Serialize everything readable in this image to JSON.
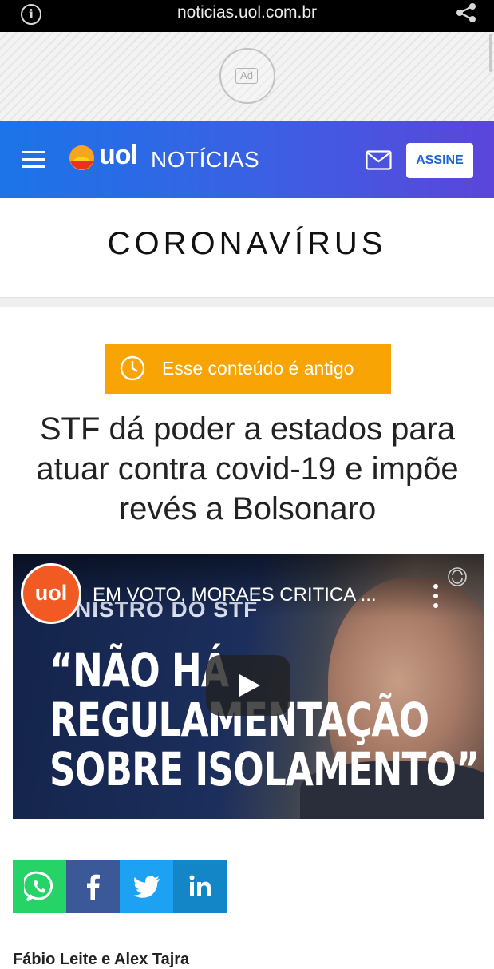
{
  "browser": {
    "url": "noticias.uol.com.br"
  },
  "ad": {
    "label": "Ad"
  },
  "header": {
    "brand": "uol",
    "section": "NOTÍCIAS",
    "subscribe_label": "ASSINE",
    "colors": {
      "gradient_start": "#1b74e8",
      "gradient_end": "#5b45da"
    }
  },
  "section_title": "CORONAVÍRUS",
  "article": {
    "old_content_notice": "Esse conteúdo é antigo",
    "notice_color": "#f7a404",
    "headline": "STF dá poder a estados para atuar contra covid-19 e impõe revés a Bolsonaro",
    "byline": "Fábio Leite e Alex Tajra"
  },
  "video": {
    "channel_logo_text": "uol",
    "title": "EM VOTO, MORAES CRITICA ...",
    "ticker": "NISTRO DO STF",
    "quote_lines": [
      "“NÃO HÁ",
      "REGULAMENTAÇÃO",
      "SOBRE ISOLAMENTO”"
    ]
  },
  "share": {
    "buttons": [
      {
        "name": "whatsapp",
        "icon": "whatsapp-icon",
        "color": "#25d366"
      },
      {
        "name": "facebook",
        "icon": "facebook-icon",
        "color": "#3b5998"
      },
      {
        "name": "twitter",
        "icon": "twitter-icon",
        "color": "#1da1f2"
      },
      {
        "name": "linkedin",
        "icon": "linkedin-icon",
        "color": "#0077b5"
      }
    ]
  }
}
